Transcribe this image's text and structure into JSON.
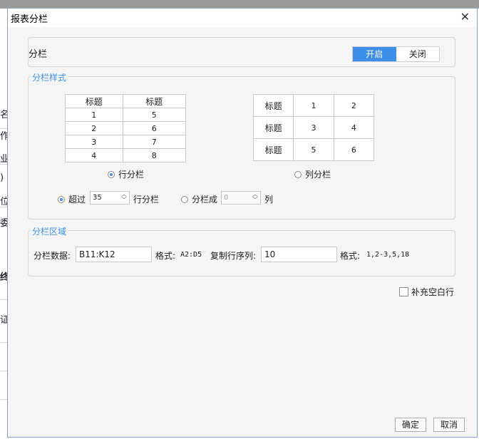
{
  "background": {
    "left_chars": [
      "名",
      "作",
      "业",
      ")",
      "位",
      "委",
      "终",
      "证"
    ]
  },
  "dialog": {
    "title": "报表分栏",
    "close_glyph": "✕",
    "toggle_label": "分栏",
    "switch": {
      "on": "开启",
      "off": "关闭",
      "active": "on"
    },
    "style_section": {
      "legend": "分栏样式",
      "row_table": {
        "header": [
          "标题",
          "标题"
        ],
        "rows": [
          [
            "1",
            "5"
          ],
          [
            "2",
            "6"
          ],
          [
            "3",
            "7"
          ],
          [
            "4",
            "8"
          ]
        ]
      },
      "col_table": {
        "rows": [
          [
            "标题",
            "1",
            "2"
          ],
          [
            "标题",
            "3",
            "4"
          ],
          [
            "标题",
            "5",
            "6"
          ]
        ]
      },
      "row_radio_label": "行分栏",
      "col_radio_label": "列分栏",
      "exceed_label": "超过",
      "exceed_value": "35",
      "exceed_suffix": "行分栏",
      "split_label": "分栏成",
      "split_value": "0",
      "split_suffix": "列"
    },
    "area_section": {
      "legend": "分栏区域",
      "data_label": "分栏数据:",
      "data_value": "B11:K12",
      "format_label_1": "格式:",
      "format_example_1": "A2:D5",
      "copy_label": "复制行序列:",
      "copy_value": "10",
      "format_label_2": "格式:",
      "format_example_2": "1,2-3,5,18"
    },
    "fill_blank_label": "补充空白行",
    "ok_label": "确定",
    "cancel_label": "取消"
  }
}
